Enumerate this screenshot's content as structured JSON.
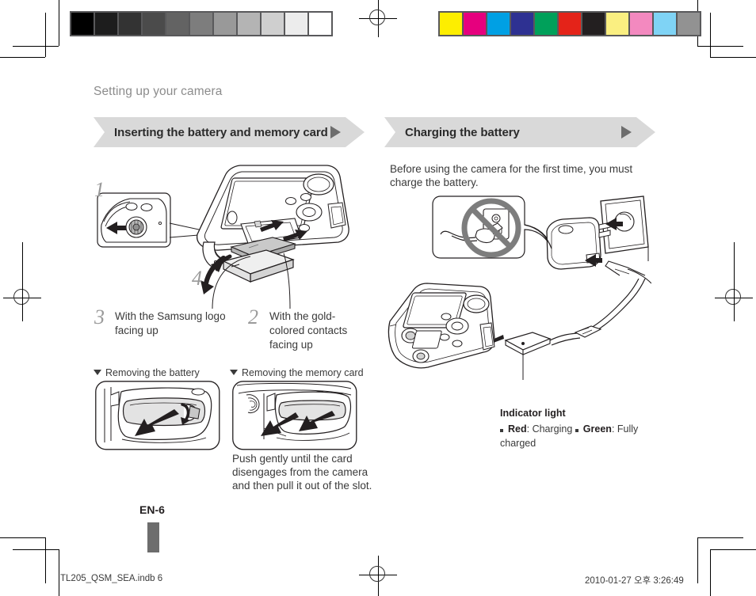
{
  "document": {
    "kicker": "Setting up your camera",
    "page_label": "EN-6"
  },
  "sections": [
    {
      "id": "inserting",
      "title": "Inserting the battery and memory card",
      "arrow_icon": "triangle-right-icon"
    },
    {
      "id": "charging",
      "title": "Charging the battery",
      "arrow_icon": "triangle-right-icon"
    }
  ],
  "left_column": {
    "steps": [
      {
        "number": "1",
        "label": ""
      },
      {
        "number": "4",
        "label": ""
      },
      {
        "number": "3",
        "label": "With the Samsung logo facing up"
      },
      {
        "number": "2",
        "label": "With the gold-colored contacts facing up"
      }
    ],
    "subheads": [
      {
        "id": "removing-battery",
        "text": "Removing the battery"
      },
      {
        "id": "removing-memory-card",
        "text": "Removing the memory card"
      }
    ],
    "memory_card_note": "Push gently until the card disengages from the camera and then pull it out of the slot."
  },
  "right_column": {
    "intro": "Before using the camera for the first time, you must charge the battery.",
    "indicator": {
      "heading": "Indicator light",
      "items": [
        {
          "label": "Red",
          "separator": ": ",
          "value": "Charging"
        },
        {
          "label": "Green",
          "separator": ": ",
          "value": "Fully charged"
        }
      ]
    }
  },
  "footer": {
    "left": "TL205_QSM_SEA.indb   6",
    "right": "2010-01-27   오후 3:26:49"
  },
  "print_marks": {
    "grayscale_strip": [
      "#000000",
      "#1d1d1d",
      "#333333",
      "#4b4b4b",
      "#636363",
      "#7d7d7d",
      "#999999",
      "#b4b4b4",
      "#cfcfcf",
      "#ececec",
      "#ffffff"
    ],
    "color_strip": [
      "#fdee00",
      "#e6007e",
      "#00a0e4",
      "#2e3192",
      "#00a05a",
      "#e42319",
      "#231f20",
      "#faef81",
      "#f389bf",
      "#7fd3f5",
      "#929292"
    ],
    "strip_border": "#59595b"
  }
}
